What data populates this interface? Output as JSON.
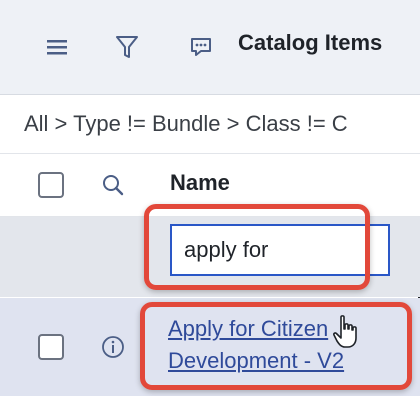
{
  "header": {
    "menu_icon": "hamburger-menu-icon",
    "filter_icon": "funnel-filter-icon",
    "chat_icon": "chat-bubble-icon",
    "title": "Catalog Items"
  },
  "breadcrumb": {
    "text": "All > Type != Bundle > Class != C"
  },
  "columns": {
    "search_icon": "magnifier-search-icon",
    "name_header": "Name"
  },
  "filter": {
    "search_value": "apply for"
  },
  "rows": [
    {
      "info_icon": "info-circle-icon",
      "name_line1": "Apply for Citizen",
      "name_line2": "Development - V2"
    }
  ],
  "colors": {
    "accent": "#2a57c7",
    "highlight": "#e2483a",
    "link": "#2f4a9a"
  }
}
